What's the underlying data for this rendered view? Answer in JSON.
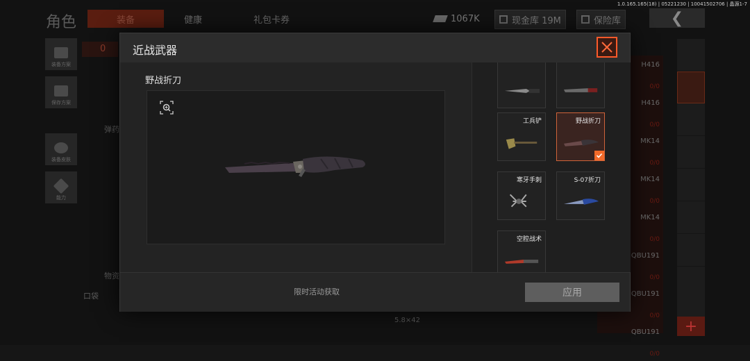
{
  "version_text": "1.0.165.165(18) | 05221230 | 10041502706 | 晶源1-7",
  "background": {
    "page_title": "角色",
    "tabs": [
      "装备",
      "健康",
      "礼包卡券"
    ],
    "stats": {
      "cash": "1067K",
      "vault_cash": "现金库 19M",
      "safe": "保险库"
    },
    "left_buttons": [
      "装备方案",
      "保存方案",
      "装备皮肤",
      "能力"
    ],
    "count_badge": "0",
    "labels": {
      "ammo": "弹药",
      "items": "物资",
      "pocket": "口袋"
    },
    "ammo_info": "5.8×42",
    "weapon_list": [
      {
        "name": "H416",
        "count": "0/0"
      },
      {
        "name": "H416",
        "count": "0/0"
      },
      {
        "name": "MK14",
        "count": "0/0"
      },
      {
        "name": "MK14",
        "count": "0/0"
      },
      {
        "name": "MK14",
        "count": "0/0"
      },
      {
        "name": "QBU191",
        "count": "0/0"
      },
      {
        "name": "QBU191",
        "count": "0/0"
      },
      {
        "name": "QBU191",
        "count": "0/0"
      }
    ],
    "plus_label": "+"
  },
  "modal": {
    "title": "近战武器",
    "selected_weapon": "野战折刀",
    "options": [
      {
        "label": "",
        "icon": "bayonet"
      },
      {
        "label": "",
        "icon": "machete"
      },
      {
        "label": "工兵铲",
        "icon": "shovel"
      },
      {
        "label": "野战折刀",
        "icon": "folding-knife",
        "selected": true
      },
      {
        "label": "寒牙手刺",
        "icon": "claw-blades"
      },
      {
        "label": "S-07折刀",
        "icon": "blue-knife"
      },
      {
        "label": "空腔战术",
        "icon": "red-knife"
      }
    ],
    "source_text": "限时活动获取",
    "apply_label": "应用"
  }
}
